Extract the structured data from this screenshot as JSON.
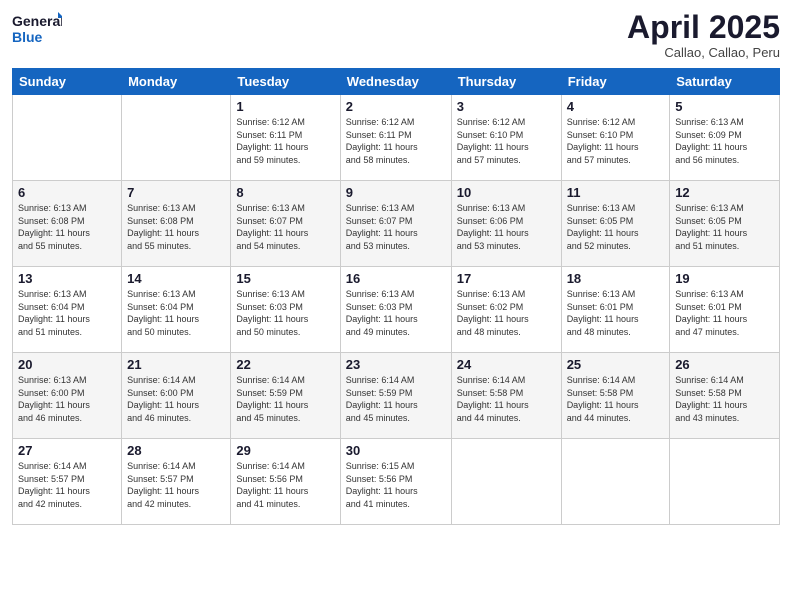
{
  "logo": {
    "line1": "General",
    "line2": "Blue"
  },
  "title": "April 2025",
  "subtitle": "Callao, Callao, Peru",
  "weekdays": [
    "Sunday",
    "Monday",
    "Tuesday",
    "Wednesday",
    "Thursday",
    "Friday",
    "Saturday"
  ],
  "weeks": [
    [
      {
        "day": "",
        "detail": ""
      },
      {
        "day": "",
        "detail": ""
      },
      {
        "day": "1",
        "detail": "Sunrise: 6:12 AM\nSunset: 6:11 PM\nDaylight: 11 hours\nand 59 minutes."
      },
      {
        "day": "2",
        "detail": "Sunrise: 6:12 AM\nSunset: 6:11 PM\nDaylight: 11 hours\nand 58 minutes."
      },
      {
        "day": "3",
        "detail": "Sunrise: 6:12 AM\nSunset: 6:10 PM\nDaylight: 11 hours\nand 57 minutes."
      },
      {
        "day": "4",
        "detail": "Sunrise: 6:12 AM\nSunset: 6:10 PM\nDaylight: 11 hours\nand 57 minutes."
      },
      {
        "day": "5",
        "detail": "Sunrise: 6:13 AM\nSunset: 6:09 PM\nDaylight: 11 hours\nand 56 minutes."
      }
    ],
    [
      {
        "day": "6",
        "detail": "Sunrise: 6:13 AM\nSunset: 6:08 PM\nDaylight: 11 hours\nand 55 minutes."
      },
      {
        "day": "7",
        "detail": "Sunrise: 6:13 AM\nSunset: 6:08 PM\nDaylight: 11 hours\nand 55 minutes."
      },
      {
        "day": "8",
        "detail": "Sunrise: 6:13 AM\nSunset: 6:07 PM\nDaylight: 11 hours\nand 54 minutes."
      },
      {
        "day": "9",
        "detail": "Sunrise: 6:13 AM\nSunset: 6:07 PM\nDaylight: 11 hours\nand 53 minutes."
      },
      {
        "day": "10",
        "detail": "Sunrise: 6:13 AM\nSunset: 6:06 PM\nDaylight: 11 hours\nand 53 minutes."
      },
      {
        "day": "11",
        "detail": "Sunrise: 6:13 AM\nSunset: 6:05 PM\nDaylight: 11 hours\nand 52 minutes."
      },
      {
        "day": "12",
        "detail": "Sunrise: 6:13 AM\nSunset: 6:05 PM\nDaylight: 11 hours\nand 51 minutes."
      }
    ],
    [
      {
        "day": "13",
        "detail": "Sunrise: 6:13 AM\nSunset: 6:04 PM\nDaylight: 11 hours\nand 51 minutes."
      },
      {
        "day": "14",
        "detail": "Sunrise: 6:13 AM\nSunset: 6:04 PM\nDaylight: 11 hours\nand 50 minutes."
      },
      {
        "day": "15",
        "detail": "Sunrise: 6:13 AM\nSunset: 6:03 PM\nDaylight: 11 hours\nand 50 minutes."
      },
      {
        "day": "16",
        "detail": "Sunrise: 6:13 AM\nSunset: 6:03 PM\nDaylight: 11 hours\nand 49 minutes."
      },
      {
        "day": "17",
        "detail": "Sunrise: 6:13 AM\nSunset: 6:02 PM\nDaylight: 11 hours\nand 48 minutes."
      },
      {
        "day": "18",
        "detail": "Sunrise: 6:13 AM\nSunset: 6:01 PM\nDaylight: 11 hours\nand 48 minutes."
      },
      {
        "day": "19",
        "detail": "Sunrise: 6:13 AM\nSunset: 6:01 PM\nDaylight: 11 hours\nand 47 minutes."
      }
    ],
    [
      {
        "day": "20",
        "detail": "Sunrise: 6:13 AM\nSunset: 6:00 PM\nDaylight: 11 hours\nand 46 minutes."
      },
      {
        "day": "21",
        "detail": "Sunrise: 6:14 AM\nSunset: 6:00 PM\nDaylight: 11 hours\nand 46 minutes."
      },
      {
        "day": "22",
        "detail": "Sunrise: 6:14 AM\nSunset: 5:59 PM\nDaylight: 11 hours\nand 45 minutes."
      },
      {
        "day": "23",
        "detail": "Sunrise: 6:14 AM\nSunset: 5:59 PM\nDaylight: 11 hours\nand 45 minutes."
      },
      {
        "day": "24",
        "detail": "Sunrise: 6:14 AM\nSunset: 5:58 PM\nDaylight: 11 hours\nand 44 minutes."
      },
      {
        "day": "25",
        "detail": "Sunrise: 6:14 AM\nSunset: 5:58 PM\nDaylight: 11 hours\nand 44 minutes."
      },
      {
        "day": "26",
        "detail": "Sunrise: 6:14 AM\nSunset: 5:58 PM\nDaylight: 11 hours\nand 43 minutes."
      }
    ],
    [
      {
        "day": "27",
        "detail": "Sunrise: 6:14 AM\nSunset: 5:57 PM\nDaylight: 11 hours\nand 42 minutes."
      },
      {
        "day": "28",
        "detail": "Sunrise: 6:14 AM\nSunset: 5:57 PM\nDaylight: 11 hours\nand 42 minutes."
      },
      {
        "day": "29",
        "detail": "Sunrise: 6:14 AM\nSunset: 5:56 PM\nDaylight: 11 hours\nand 41 minutes."
      },
      {
        "day": "30",
        "detail": "Sunrise: 6:15 AM\nSunset: 5:56 PM\nDaylight: 11 hours\nand 41 minutes."
      },
      {
        "day": "",
        "detail": ""
      },
      {
        "day": "",
        "detail": ""
      },
      {
        "day": "",
        "detail": ""
      }
    ]
  ]
}
